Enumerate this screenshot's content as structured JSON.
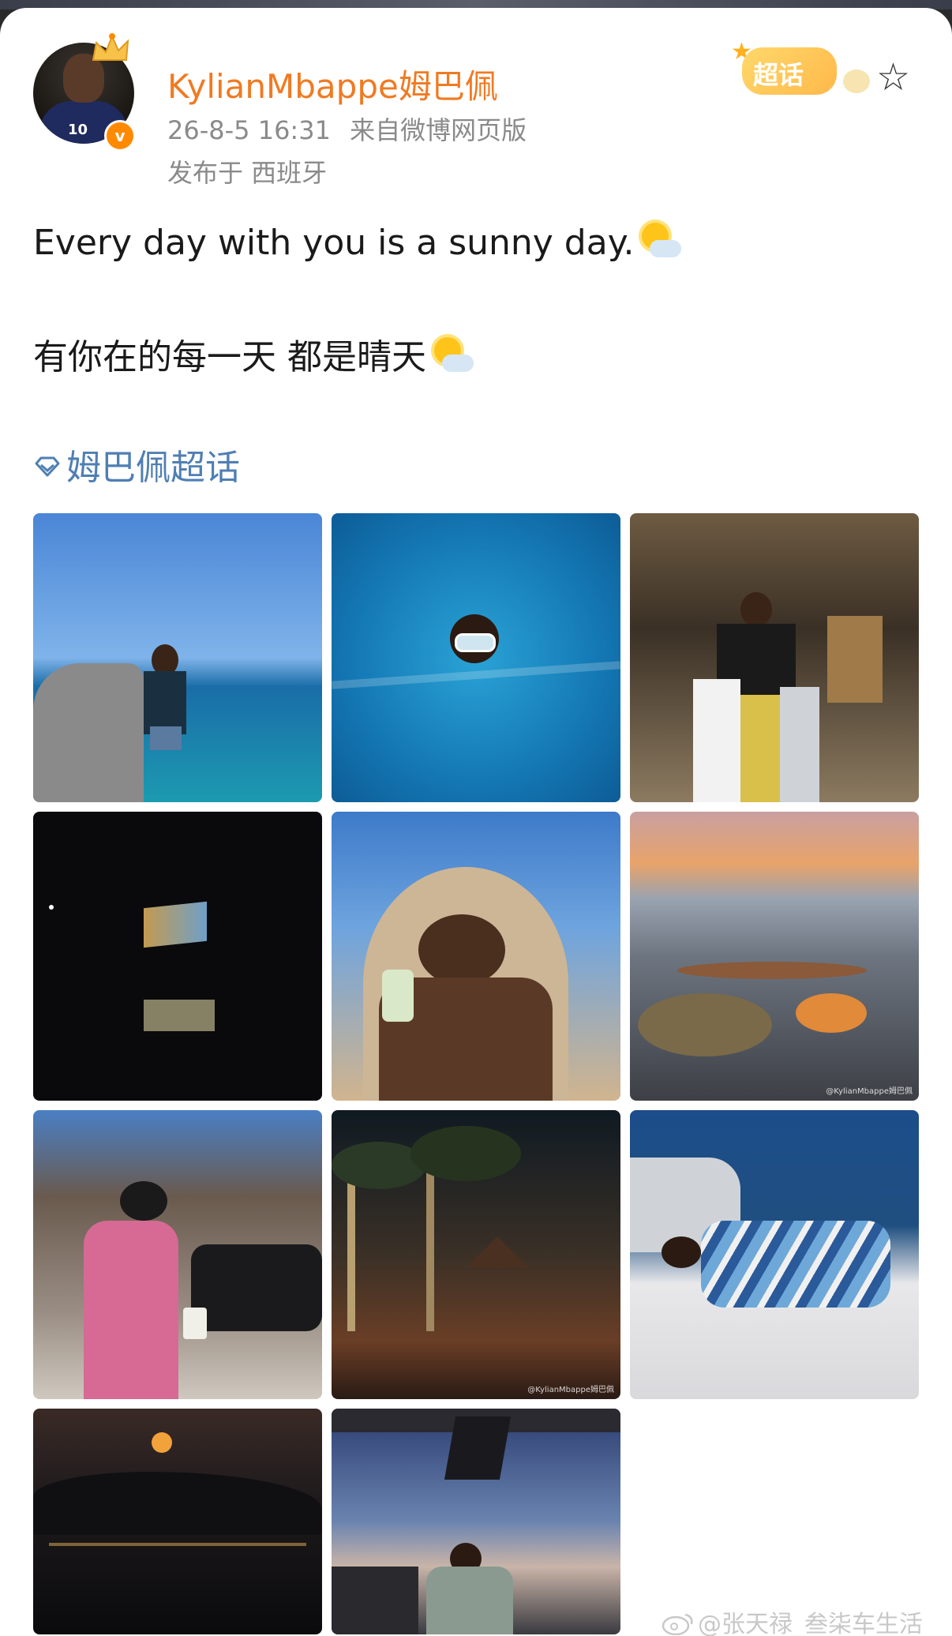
{
  "post": {
    "username": "KylianMbappe姆巴佩",
    "timestamp": "26-8-5 16:31",
    "source": "来自微博网页版",
    "location": "发布于 西班牙",
    "verified_badge": "v",
    "supertopic_badge": "超话",
    "text_en": "Every day with you is a sunny day.",
    "text_zh": "有你在的每一天 都是晴天",
    "topic_tag": "姆巴佩超话"
  },
  "icons": {
    "weather": "sun-behind-cloud-icon",
    "favorite": "star-icon",
    "topic": "diamond-icon"
  },
  "photos": {
    "watermark": "@KylianMbappe姆巴佩",
    "count": 11
  },
  "footer": {
    "watermark": "@张天禄_叁柒车生活"
  },
  "colors": {
    "username": "#f07a22",
    "meta": "#8a8a8a",
    "topic": "#4f7fb3",
    "badge": "#ff8a00"
  }
}
